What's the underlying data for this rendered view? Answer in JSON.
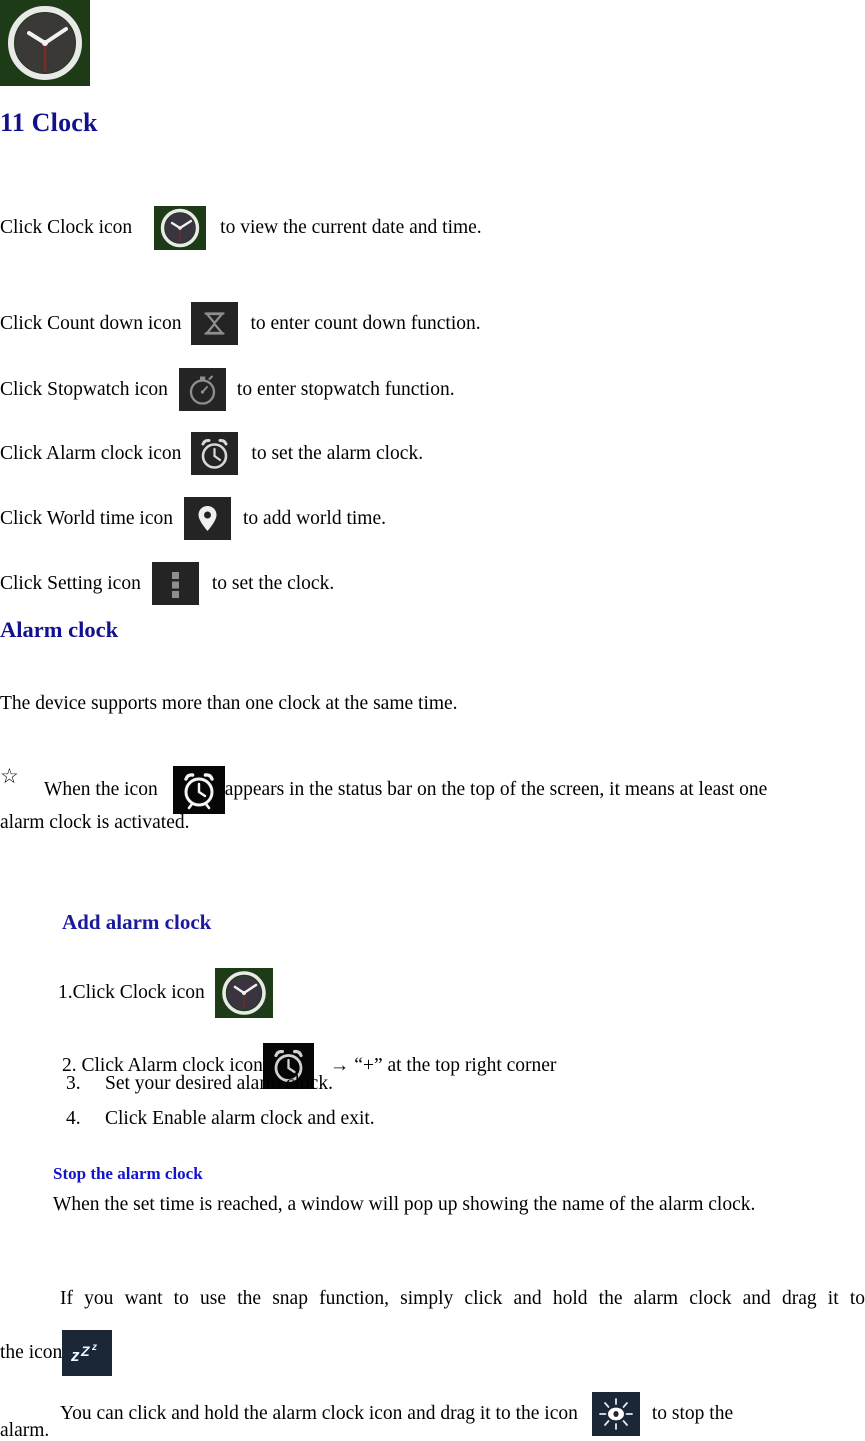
{
  "document": {
    "title": "11 Clock",
    "header_icon": "clock-app-icon"
  },
  "intro": {
    "clock_line_before": "Click Clock icon",
    "clock_line_after": "to view the current date and time.",
    "rows": [
      {
        "icon": "hourglass-countdown-icon",
        "before": "Click Count down icon",
        "after": "to enter count down function."
      },
      {
        "icon": "stopwatch-icon",
        "before": "Click Stopwatch icon",
        "after": "to enter stopwatch function."
      },
      {
        "icon": "alarm-clock-icon",
        "before": "Click Alarm clock icon",
        "after": "to set the alarm clock."
      },
      {
        "icon": "map-pin-world-time-icon",
        "before": "Click World time icon",
        "after": "to add world time."
      },
      {
        "icon": "overflow-menu-icon",
        "before": "Click Setting icon",
        "after": "to set the clock."
      }
    ]
  },
  "alarm_clock_section": {
    "heading": "Alarm clock",
    "intro_text": "The device supports more than one clock at the same time.",
    "star_bullet": {
      "bullet_glyph": "☆",
      "before": "When the icon",
      "after": "appears in the status bar on the top of the screen, it means at least one",
      "continuation": "alarm clock is activated."
    }
  },
  "add_alarm_clock": {
    "heading": "Add alarm clock",
    "step1_before": "1.Click Clock icon",
    "step2_before": "2. Click Alarm clock icon",
    "step2_after": "→ “+” at the top right corner",
    "step3": "3.  Set your desired alarm clock.",
    "step4": "4.  Click Enable alarm clock and exit."
  },
  "stop_alarm_clock": {
    "heading": "Stop the alarm clock",
    "line1": "When the set time is reached, a window will pop up showing the name of the alarm clock.",
    "snap_text": "If you want to use the snap function, simply click and hold the alarm clock and drag it to",
    "snap_icon_before": "the icon",
    "snooze_icon": "snooze-zzz-icon",
    "dismiss_before": "You can click and hold the alarm clock icon and drag it to the icon",
    "dismiss_icon": "sunburst-dismiss-icon",
    "dismiss_after": "to stop the",
    "dismiss_tail": "alarm."
  },
  "colors": {
    "heading_navy": "#11118e",
    "subheading_blue": "#1414cc",
    "icon_green_bg": "#1d3b16",
    "icon_dark_bg": "#242424",
    "icon_black_bg": "#060606",
    "icon_navy_bg": "#1b2636",
    "text_black": "#000000"
  }
}
